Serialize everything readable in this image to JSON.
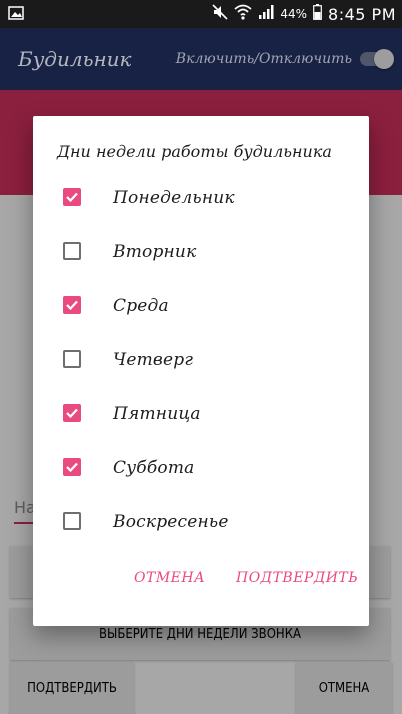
{
  "status_bar": {
    "battery_percent": "44%",
    "time": "8:45 PM"
  },
  "app_bar": {
    "title": "Будильник",
    "toggle_label": "Включить/Отключить",
    "toggle_on": false
  },
  "background": {
    "input_text": "На",
    "select_days_button": "ВЫБЕРИТЕ ДНИ НЕДЕЛИ ЗВОНКА",
    "confirm_button": "ПОДТВЕРДИТЬ",
    "cancel_button": "ОТМЕНА"
  },
  "dialog": {
    "title": "Дни недели работы будильника",
    "days": [
      {
        "label": "Понедельник",
        "checked": true
      },
      {
        "label": "Вторник",
        "checked": false
      },
      {
        "label": "Среда",
        "checked": true
      },
      {
        "label": "Четверг",
        "checked": false
      },
      {
        "label": "Пятница",
        "checked": true
      },
      {
        "label": "Суббота",
        "checked": true
      },
      {
        "label": "Воскресенье",
        "checked": false
      }
    ],
    "cancel_label": "ОТМЕНА",
    "confirm_label": "ПОДТВЕРДИТЬ"
  },
  "colors": {
    "app_bar": "#1f2c59",
    "accent_pink": "#e94a80",
    "band_pink": "#b32850",
    "status_bar": "#1a1a1a"
  }
}
